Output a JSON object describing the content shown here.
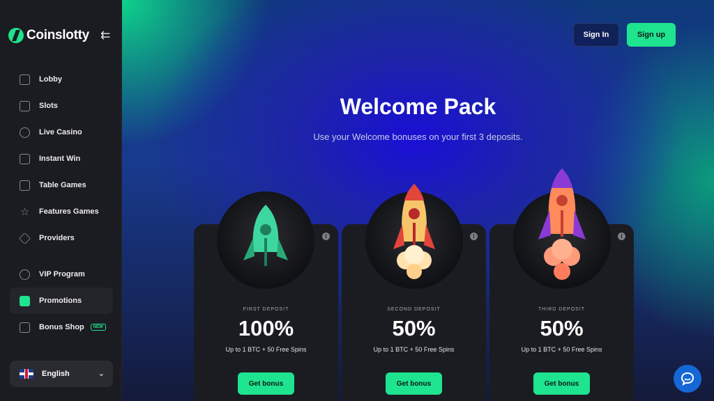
{
  "brand": {
    "name": "Coinslotty"
  },
  "sidebar": {
    "items": [
      {
        "label": "Lobby",
        "icon": "grid-icon"
      },
      {
        "label": "Slots",
        "icon": "seven-icon"
      },
      {
        "label": "Live Casino",
        "icon": "chip-icon"
      },
      {
        "label": "Instant Win",
        "icon": "rocket-icon"
      },
      {
        "label": "Table Games",
        "icon": "cards-icon"
      },
      {
        "label": "Features Games",
        "icon": "star-icon"
      },
      {
        "label": "Providers",
        "icon": "diamond-icon"
      }
    ],
    "items2": [
      {
        "label": "VIP Program",
        "icon": "medal-icon"
      },
      {
        "label": "Promotions",
        "icon": "gift-icon"
      },
      {
        "label": "Bonus Shop",
        "icon": "bag-icon",
        "badge": "NEW"
      }
    ],
    "language": "English"
  },
  "header": {
    "signin": "Sign In",
    "signup": "Sign up"
  },
  "hero": {
    "title": "Welcome Pack",
    "subtitle": "Use your Welcome bonuses on your first 3 deposits."
  },
  "cards": [
    {
      "label": "FIRST DEPOSIT",
      "percent": "100%",
      "desc": "Up to 1 BTC + 50 Free Spins",
      "button": "Get bonus",
      "rocket_color": "#3fd7a0"
    },
    {
      "label": "SECOND DEPOSIT",
      "percent": "50%",
      "desc": "Up to 1 BTC + 50 Free Spins",
      "button": "Get bonus",
      "rocket_color": "#f7c66a"
    },
    {
      "label": "THIRD DEPOSIT",
      "percent": "50%",
      "desc": "Up to 1 BTC + 50 Free Spins",
      "button": "Get bonus",
      "rocket_color": "#ff8a5b"
    }
  ],
  "colors": {
    "accent": "#1ee38f",
    "sidebar_bg": "#1b1c21",
    "chat": "#1567d6"
  }
}
